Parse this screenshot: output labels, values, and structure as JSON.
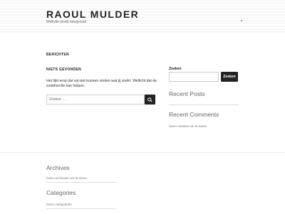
{
  "site": {
    "title": "RAOUL MULDER",
    "description": "Website wordt aangevuld"
  },
  "main": {
    "page_heading": "BERICHTEN",
    "not_found_title": "NIETS GEVONDEN",
    "not_found_text": "Het lijkt erop dat wij niet kunnen vinden wat jij zoekt. Wellicht dat de zoekfunctie kan helpen.",
    "search": {
      "placeholder": "Zoeken …"
    }
  },
  "sidebar": {
    "search_label": "Zoeken",
    "search_button": "Zoeken",
    "recent_posts_title": "Recent Posts",
    "recent_comments_title": "Recent Comments",
    "recent_comments_empty": "Geen reacties om te tonen."
  },
  "footer": {
    "archives_title": "Archives",
    "archives_empty": "Geen archieven om te tonen.",
    "categories_title": "Categories",
    "categories_empty": "Geen categorieën"
  }
}
